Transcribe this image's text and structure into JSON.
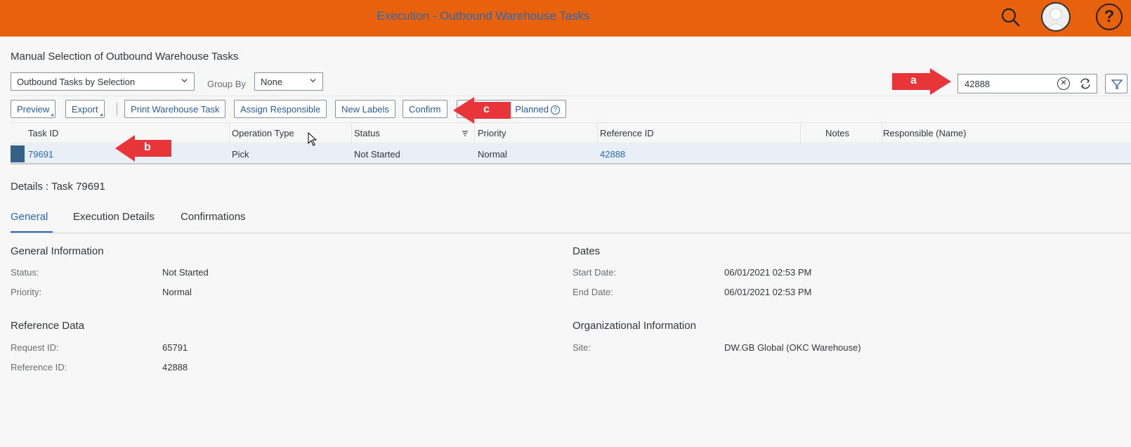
{
  "shell": {
    "title": "Execution - Outbound Warehouse Tasks",
    "icons": [
      "search-icon",
      "user-avatar-icon",
      "help-icon"
    ],
    "help_glyph": "?"
  },
  "page": {
    "title": "Manual Selection of Outbound Warehouse Tasks"
  },
  "selection": {
    "variant_value": "Outbound Tasks by Selection",
    "group_by_label": "Group By",
    "group_by_value": "None",
    "search_value": "42888"
  },
  "toolbar": {
    "preview": "Preview",
    "export": "Export",
    "print": "Print Warehouse Task",
    "assign": "Assign Responsible",
    "new_labels": "New Labels",
    "confirm": "Confirm",
    "planned": "Planned"
  },
  "table": {
    "headers": [
      "Task ID",
      "Operation Type",
      "Status",
      "Priority",
      "Reference ID",
      "Notes",
      "Responsible (Name)"
    ],
    "rows": [
      {
        "task_id": "79691",
        "operation_type": "Pick",
        "status": "Not Started",
        "priority": "Normal",
        "reference_id": "42888",
        "notes": "",
        "responsible": ""
      }
    ]
  },
  "details": {
    "title": "Details : Task 79691",
    "tabs": [
      "General",
      "Execution Details",
      "Confirmations"
    ],
    "general_info": {
      "title": "General Information",
      "status_label": "Status:",
      "status_value": "Not Started",
      "priority_label": "Priority:",
      "priority_value": "Normal"
    },
    "dates": {
      "title": "Dates",
      "start_label": "Start Date:",
      "start_value": "06/01/2021 02:53 PM",
      "end_label": "End Date:",
      "end_value": "06/01/2021 02:53 PM"
    },
    "reference": {
      "title": "Reference Data",
      "request_label": "Request ID:",
      "request_value": "65791",
      "reference_label": "Reference ID:",
      "reference_value": "42888"
    },
    "org": {
      "title": "Organizational Information",
      "site_label": "Site:",
      "site_value": "DW.GB Global (OKC Warehouse)"
    }
  },
  "annotations": {
    "a": "a",
    "b": "b",
    "c": "c",
    "color": "#e8353a"
  },
  "colors": {
    "shell": "#e8620e",
    "link": "#2a67b1",
    "selected_row": "#e8eff6"
  }
}
